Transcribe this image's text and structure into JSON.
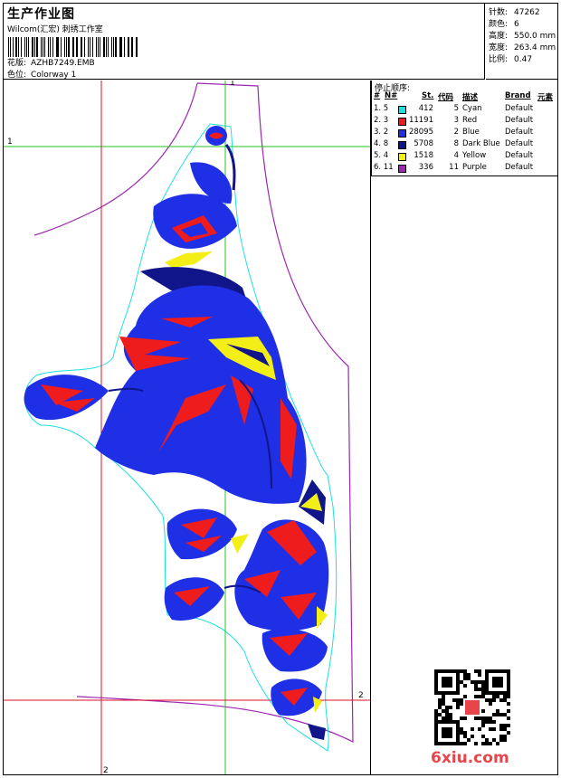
{
  "header": {
    "title": "生产作业图",
    "company": "Wilcom(汇宏) 刺绣工作室",
    "design_label": "花版:",
    "design_value": "AZHB7249.EMB",
    "colorway_label": "色位:",
    "colorway_value": "Colorway 1"
  },
  "stats": [
    {
      "label": "针数:",
      "value": "47262"
    },
    {
      "label": "颜色:",
      "value": "6"
    },
    {
      "label": "高度:",
      "value": "550.0 mm"
    },
    {
      "label": "宽度:",
      "value": "263.4 mm"
    },
    {
      "label": "比例:",
      "value": "0.47"
    }
  ],
  "sequence": {
    "title": "停止顺序:",
    "columns": [
      "#",
      "N#",
      "St.",
      "代码",
      "描述",
      "Brand",
      "元素"
    ],
    "rows": [
      {
        "idx": "1. 5",
        "color": "#1ee0e0",
        "stitches": "412",
        "code": "5",
        "desc": "Cyan",
        "brand": "Default"
      },
      {
        "idx": "2. 3",
        "color": "#ee1c1c",
        "stitches": "11191",
        "code": "3",
        "desc": "Red",
        "brand": "Default"
      },
      {
        "idx": "3. 2",
        "color": "#1f2fe6",
        "stitches": "28095",
        "code": "2",
        "desc": "Blue",
        "brand": "Default"
      },
      {
        "idx": "4. 8",
        "color": "#10168a",
        "stitches": "5708",
        "code": "8",
        "desc": "Dark Blue",
        "brand": "Default"
      },
      {
        "idx": "5. 4",
        "color": "#f2ee16",
        "stitches": "1518",
        "code": "4",
        "desc": "Yellow",
        "brand": "Default"
      },
      {
        "idx": "6. 11",
        "color": "#9c27b0",
        "stitches": "336",
        "code": "11",
        "desc": "Purple",
        "brand": "Default"
      }
    ]
  },
  "guides": {
    "v1": "1",
    "h1": "1",
    "v2": "2",
    "h2": "2"
  },
  "watermark": "6xiu.com"
}
